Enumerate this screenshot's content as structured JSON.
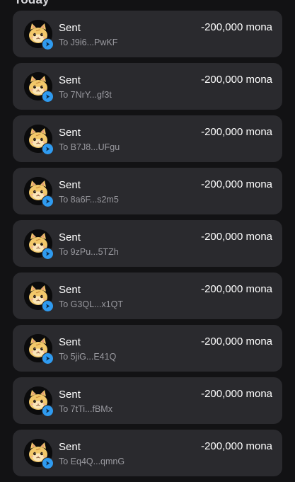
{
  "section": {
    "header": "Today"
  },
  "transactions": [
    {
      "title": "Sent",
      "subtitle": "To J9i6...PwKF",
      "amount": "-200,000 mona",
      "avatar_icon": "cat-avatar-icon",
      "badge_icon": "send-arrow-icon"
    },
    {
      "title": "Sent",
      "subtitle": "To 7NrY...gf3t",
      "amount": "-200,000 mona",
      "avatar_icon": "cat-avatar-icon",
      "badge_icon": "send-arrow-icon"
    },
    {
      "title": "Sent",
      "subtitle": "To B7J8...UFgu",
      "amount": "-200,000 mona",
      "avatar_icon": "cat-avatar-icon",
      "badge_icon": "send-arrow-icon"
    },
    {
      "title": "Sent",
      "subtitle": "To 8a6F...s2m5",
      "amount": "-200,000 mona",
      "avatar_icon": "cat-avatar-icon",
      "badge_icon": "send-arrow-icon"
    },
    {
      "title": "Sent",
      "subtitle": "To 9zPu...5TZh",
      "amount": "-200,000 mona",
      "avatar_icon": "cat-avatar-icon",
      "badge_icon": "send-arrow-icon"
    },
    {
      "title": "Sent",
      "subtitle": "To G3QL...x1QT",
      "amount": "-200,000 mona",
      "avatar_icon": "cat-avatar-icon",
      "badge_icon": "send-arrow-icon"
    },
    {
      "title": "Sent",
      "subtitle": "To 5jiG...E41Q",
      "amount": "-200,000 mona",
      "avatar_icon": "cat-avatar-icon",
      "badge_icon": "send-arrow-icon"
    },
    {
      "title": "Sent",
      "subtitle": "To 7tTi...fBMx",
      "amount": "-200,000 mona",
      "avatar_icon": "cat-avatar-icon",
      "badge_icon": "send-arrow-icon"
    },
    {
      "title": "Sent",
      "subtitle": "To Eq4Q...qmnG",
      "amount": "-200,000 mona",
      "avatar_icon": "cat-avatar-icon",
      "badge_icon": "send-arrow-icon"
    }
  ],
  "colors": {
    "background": "#121214",
    "card": "#2a2a2e",
    "badge": "#2f9bf0",
    "subtitle": "#9a9aa0",
    "avatar_bg": "#0b0b0c",
    "cat_fur": "#f2c86a"
  }
}
